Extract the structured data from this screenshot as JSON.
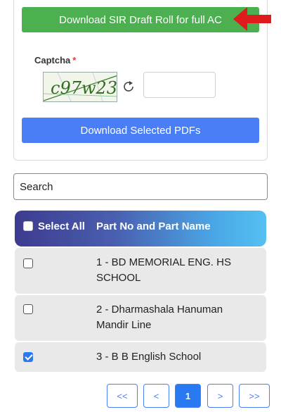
{
  "download_full": {
    "label": "Download SIR Draft Roll for full AC"
  },
  "captcha": {
    "label": "Captcha",
    "required_mark": "*",
    "image_text": "c97w23",
    "input_value": ""
  },
  "download_selected": {
    "label": "Download Selected PDFs"
  },
  "search": {
    "value": "Search"
  },
  "table": {
    "select_all_label": "Select All",
    "column_title": "Part No and Part Name",
    "rows": [
      {
        "name": "1 - BD MEMORIAL ENG. HS SCHOOL",
        "checked": false
      },
      {
        "name": "2 - Dharmashala Hanuman Mandir Line",
        "checked": false
      },
      {
        "name": "3 - B B English School",
        "checked": true
      }
    ]
  },
  "pagination": {
    "first": "<<",
    "prev": "<",
    "current": "1",
    "next": ">",
    "last": ">>"
  },
  "colors": {
    "green": "#4caf50",
    "blue": "#4a7ef7",
    "arrow_red": "#e01b1b",
    "header_gradient_start": "#3d3b8f",
    "header_gradient_end": "#55c0f2"
  }
}
